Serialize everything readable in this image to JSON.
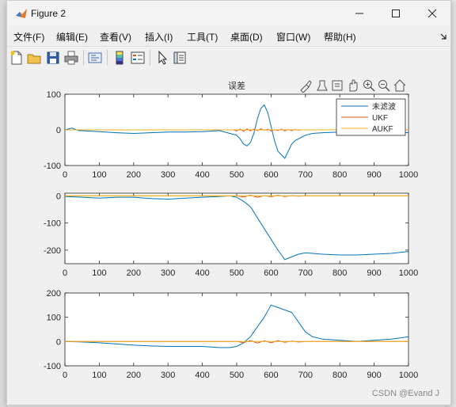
{
  "window": {
    "title": "Figure 2"
  },
  "menus": [
    "文件(F)",
    "编辑(E)",
    "查看(V)",
    "插入(I)",
    "工具(T)",
    "桌面(D)",
    "窗口(W)",
    "帮助(H)"
  ],
  "toolbar": [
    "new-figure-icon",
    "open-icon",
    "save-icon",
    "print-icon",
    "link-icon",
    "colorbar-icon",
    "legend-icon",
    "pointer-icon",
    "property-editor-icon"
  ],
  "axes_toolbar": [
    "brush-icon",
    "datatip-icon",
    "restore-icon",
    "pan-icon",
    "zoom-in-icon",
    "zoom-out-icon",
    "home-icon"
  ],
  "watermark": "CSDN @Evand J",
  "colors": {
    "series1": "#0072BD",
    "series2": "#D95319",
    "series3": "#EDB120"
  },
  "chart_data": [
    {
      "type": "line",
      "title": "误差",
      "xlim": [
        0,
        1000
      ],
      "ylim": [
        -100,
        100
      ],
      "xticks": [
        0,
        100,
        200,
        300,
        400,
        500,
        600,
        700,
        800,
        900,
        1000
      ],
      "yticks": [
        -100,
        0,
        100
      ],
      "legend": {
        "placement": "top-right",
        "entries": [
          "未滤波",
          "UKF",
          "AUKF"
        ]
      },
      "series": [
        {
          "name": "未滤波",
          "color": "#0072BD",
          "x": [
            0,
            20,
            40,
            60,
            100,
            150,
            200,
            250,
            300,
            350,
            400,
            450,
            480,
            500,
            510,
            520,
            530,
            540,
            550,
            560,
            570,
            580,
            590,
            600,
            610,
            620,
            630,
            640,
            650,
            660,
            670,
            680,
            690,
            700,
            720,
            750,
            800,
            850,
            900,
            950,
            1000
          ],
          "y": [
            0,
            5,
            -2,
            -3,
            -5,
            -8,
            -10,
            -8,
            -6,
            -6,
            -5,
            -2,
            -10,
            -15,
            -25,
            -40,
            -45,
            -35,
            -10,
            30,
            60,
            70,
            50,
            10,
            -30,
            -60,
            -70,
            -80,
            -60,
            -40,
            -30,
            -25,
            -20,
            -15,
            -10,
            -8,
            -6,
            -5,
            -3,
            -5,
            -8
          ]
        },
        {
          "name": "UKF",
          "color": "#D95319",
          "x": [
            0,
            100,
            200,
            300,
            400,
            490,
            500,
            510,
            520,
            530,
            540,
            550,
            560,
            570,
            580,
            590,
            600,
            610,
            620,
            630,
            640,
            650,
            660,
            670,
            680,
            690,
            700,
            800,
            900,
            1000
          ],
          "y": [
            0,
            0,
            0,
            0,
            0,
            0,
            -3,
            2,
            -4,
            3,
            -3,
            2,
            -2,
            3,
            -1,
            2,
            -3,
            1,
            -2,
            2,
            -3,
            1,
            -2,
            1,
            -1,
            0,
            0,
            0,
            0,
            0
          ]
        },
        {
          "name": "AUKF",
          "color": "#EDB120",
          "x": [
            0,
            200,
            400,
            500,
            600,
            700,
            800,
            1000
          ],
          "y": [
            0,
            0,
            0,
            0,
            0,
            0,
            0,
            0
          ]
        }
      ]
    },
    {
      "type": "line",
      "xlim": [
        0,
        1000
      ],
      "ylim": [
        -250,
        10
      ],
      "xticks": [
        0,
        100,
        200,
        300,
        400,
        500,
        600,
        700,
        800,
        900,
        1000
      ],
      "yticks": [
        -200,
        -100,
        0
      ],
      "series": [
        {
          "name": "",
          "color": "#0072BD",
          "x": [
            0,
            50,
            100,
            150,
            200,
            250,
            300,
            350,
            400,
            450,
            480,
            500,
            520,
            540,
            560,
            580,
            600,
            620,
            640,
            660,
            680,
            700,
            750,
            800,
            850,
            900,
            950,
            1000
          ],
          "y": [
            -2,
            -5,
            -8,
            -5,
            -5,
            -10,
            -12,
            -8,
            -5,
            -2,
            0,
            -5,
            -20,
            -40,
            -80,
            -120,
            -160,
            -200,
            -235,
            -225,
            -215,
            -210,
            -215,
            -218,
            -218,
            -215,
            -212,
            -205
          ]
        },
        {
          "name": "",
          "color": "#D95319",
          "x": [
            0,
            100,
            200,
            300,
            400,
            500,
            520,
            540,
            560,
            580,
            600,
            620,
            640,
            660,
            680,
            700,
            800,
            900,
            1000
          ],
          "y": [
            0,
            0,
            0,
            0,
            0,
            0,
            -4,
            2,
            -5,
            1,
            -3,
            2,
            -2,
            1,
            -1,
            0,
            0,
            0,
            0
          ]
        },
        {
          "name": "",
          "color": "#EDB120",
          "x": [
            0,
            250,
            500,
            750,
            1000
          ],
          "y": [
            0,
            0,
            0,
            0,
            0
          ]
        }
      ]
    },
    {
      "type": "line",
      "xlim": [
        0,
        1000
      ],
      "ylim": [
        -100,
        200
      ],
      "xticks": [
        0,
        100,
        200,
        300,
        400,
        500,
        600,
        700,
        800,
        900,
        1000
      ],
      "yticks": [
        -100,
        0,
        100,
        200
      ],
      "series": [
        {
          "name": "",
          "color": "#0072BD",
          "x": [
            0,
            50,
            100,
            150,
            200,
            250,
            300,
            350,
            400,
            450,
            480,
            500,
            520,
            540,
            560,
            580,
            600,
            620,
            640,
            660,
            680,
            700,
            720,
            750,
            800,
            850,
            900,
            950,
            1000
          ],
          "y": [
            0,
            -2,
            -5,
            -10,
            -15,
            -18,
            -20,
            -20,
            -20,
            -25,
            -25,
            -20,
            -5,
            20,
            60,
            100,
            150,
            140,
            130,
            120,
            80,
            40,
            20,
            10,
            5,
            0,
            5,
            10,
            20
          ]
        },
        {
          "name": "",
          "color": "#D95319",
          "x": [
            0,
            100,
            200,
            300,
            400,
            500,
            520,
            540,
            560,
            580,
            600,
            620,
            640,
            660,
            680,
            700,
            800,
            900,
            1000
          ],
          "y": [
            0,
            0,
            0,
            0,
            0,
            0,
            -4,
            4,
            -6,
            3,
            -5,
            4,
            -3,
            2,
            -2,
            0,
            0,
            0,
            0
          ]
        },
        {
          "name": "",
          "color": "#EDB120",
          "x": [
            0,
            250,
            500,
            750,
            1000
          ],
          "y": [
            0,
            0,
            0,
            0,
            0
          ]
        }
      ]
    }
  ]
}
